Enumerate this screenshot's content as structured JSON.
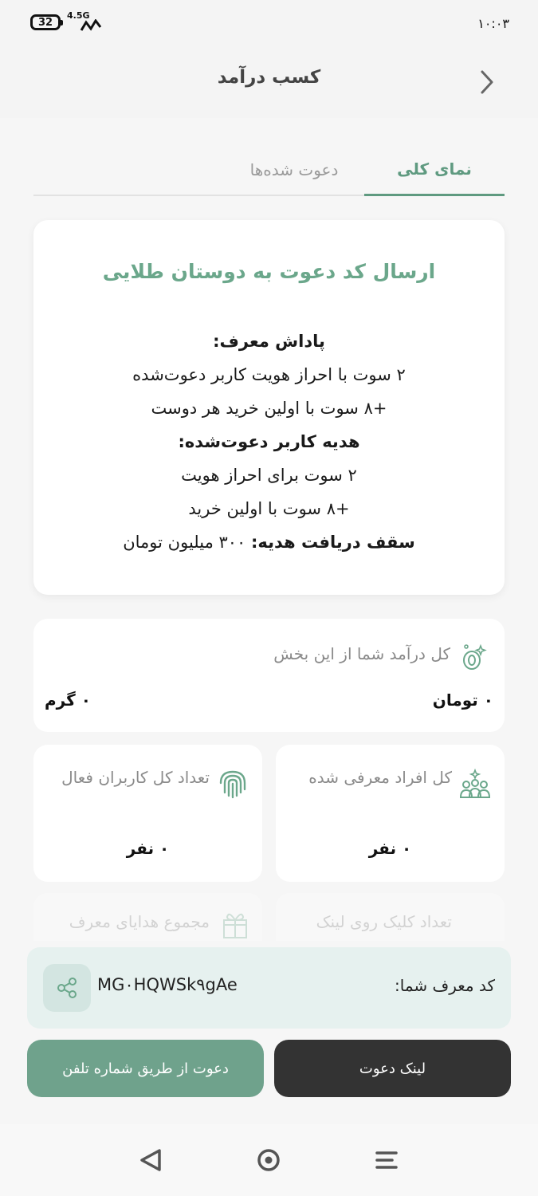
{
  "status_bar": {
    "battery": "32",
    "network": "4.5G",
    "time": "۱۰:۰۳"
  },
  "header": {
    "title": "کسب درآمد"
  },
  "tabs": [
    {
      "label": "نمای کلی",
      "active": true
    },
    {
      "label": "دعوت شده‌ها",
      "active": false
    }
  ],
  "info_card": {
    "title": "ارسال کد دعوت به دوستان طلایی",
    "referrer_heading": "پاداش معرف:",
    "referrer_line_1": "۲ سوت با احراز هویت کاربر دعوت‌شده",
    "referrer_line_2": "+۸ سوت با اولین خرید هر دوست",
    "invitee_heading": "هدیه کاربر دعوت‌شده:",
    "invitee_line_1": "۲ سوت برای احراز هویت",
    "invitee_line_2": "+۸ سوت با اولین خرید",
    "cap_label": "سقف دریافت هدیه:",
    "cap_value": "۳۰۰ میلیون تومان"
  },
  "income": {
    "label": "کل درآمد شما از این بخش",
    "toman": "۰ تومان",
    "gram": "۰ گرم"
  },
  "stats": {
    "referred": {
      "label": "کل افراد معرفی شده",
      "value": "۰ نفر"
    },
    "active_users": {
      "label": "تعداد کل کاربران فعال",
      "value": "۰ نفر"
    }
  },
  "faded_stats": {
    "clicks_label": "تعداد کلیک روی لینک",
    "gifts_label": "مجموع هدایای معرف"
  },
  "referral": {
    "label": "کد معرف شما:",
    "code": "MG۰HQWSk۹gAe"
  },
  "buttons": {
    "invite_link": "لینک دعوت",
    "invite_phone": "دعوت از طریق شماره تلفن"
  },
  "colors": {
    "accent": "#6ba78b",
    "dark_button": "#333333",
    "green_button": "#6fa28c",
    "referral_bg": "#e6f1ef"
  }
}
